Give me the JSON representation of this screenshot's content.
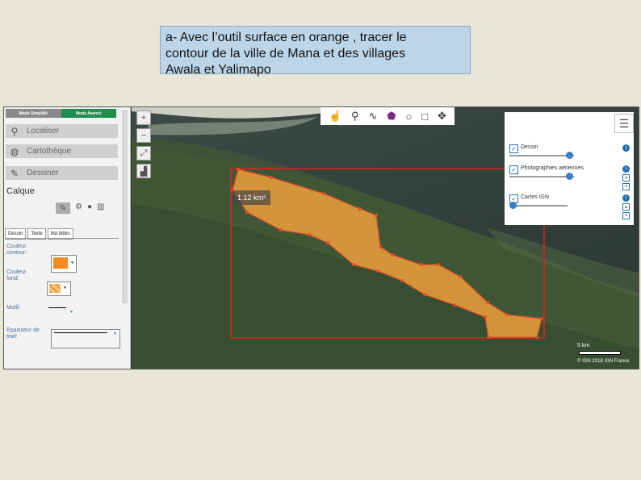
{
  "instruction": {
    "line1": "a- Avec l’outil surface en orange , tracer le",
    "line2": "contour de la ville de Mana et des villages",
    "line3": "Awala et Yalimapo"
  },
  "panel": {
    "mode_simple": "Mode Simplifié",
    "mode_advanced": "Mode Avancé",
    "sections": [
      {
        "label": "Localiser",
        "icon": "search-icon"
      },
      {
        "label": "Cartothèque",
        "icon": "globe-icon"
      },
      {
        "label": "Dessiner",
        "icon": "brush-icon"
      }
    ],
    "calque_label": "Calque",
    "tabs": [
      "Dessin",
      "Texte",
      "Ma biblio"
    ],
    "fields": {
      "couleur_contour": "Couleur\ncontour:",
      "couleur_fond": "Couleur\nfond:",
      "motif": "Motif:",
      "epaisseur": "Epaisseur de\ntrait:"
    }
  },
  "map": {
    "area_label": "1.12 km²",
    "layers": [
      {
        "name": "Dessin",
        "opacity": 0.92
      },
      {
        "name": "Photographies aériennes",
        "opacity": 0.92
      },
      {
        "name": "Cartes IGN",
        "opacity": 0.05
      }
    ],
    "scale_label": "5 km",
    "attribution": "© IGN 2018 IGN France",
    "colors": {
      "polygon_fill": "#f5a23c",
      "polygon_stroke": "#e0502a",
      "bbox_stroke": "#e02020",
      "accent_green": "#1f8f4f"
    }
  }
}
